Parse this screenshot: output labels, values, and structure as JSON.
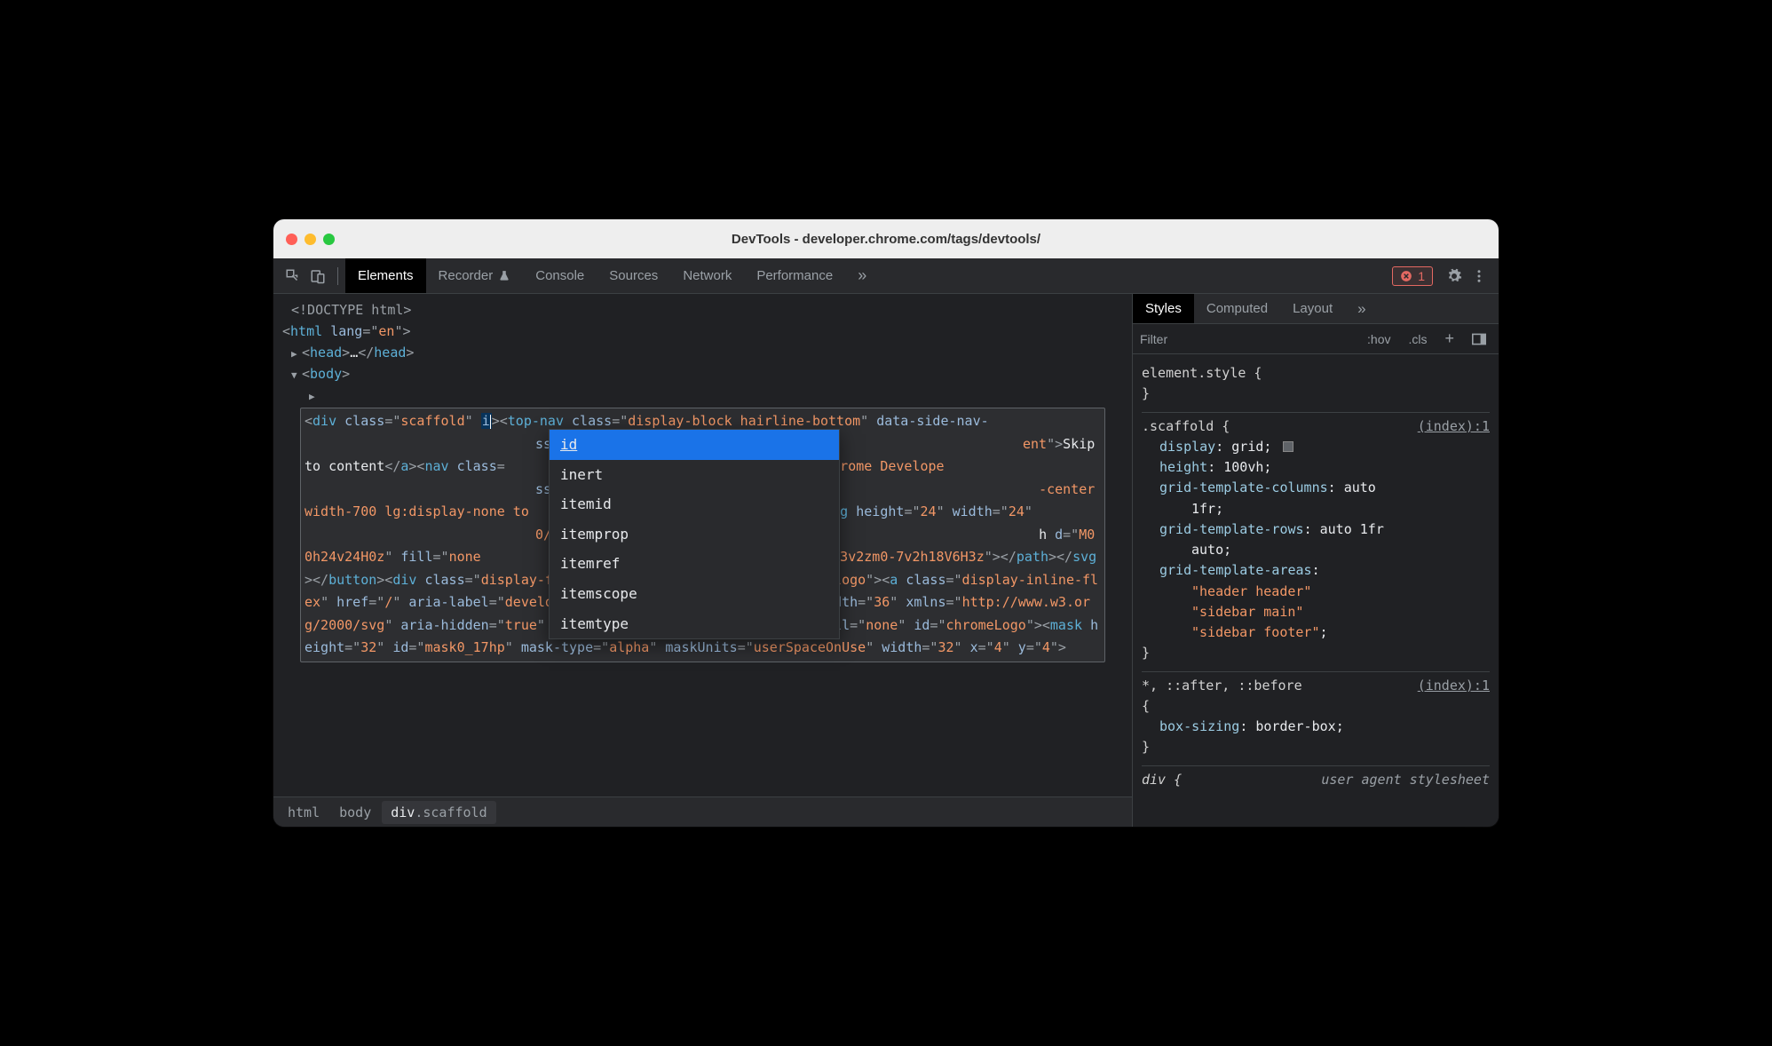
{
  "window": {
    "title": "DevTools - developer.chrome.com/tags/devtools/"
  },
  "toolbar": {
    "tabs": {
      "elements": "Elements",
      "recorder": "Recorder",
      "console": "Console",
      "sources": "Sources",
      "network": "Network",
      "performance": "Performance"
    },
    "error_count": "1"
  },
  "dom": {
    "doctype": "<!DOCTYPE html>",
    "html_open": "html",
    "html_lang_attr": "lang",
    "html_lang_val": "en",
    "head": "head",
    "body": "body",
    "editing_attr": "i",
    "html_content_lines": [
      "div class=\"scaffold\" i|><top-nav class=\"display-block hairline-",
      "bottom\" data-side-nav-                          ss=\"color-",
      "primary skip-link visu                          ent\">Skip to",
      "content</a><nav class=                          ria-",
      "label=\"Chrome Develope                          ss=\"display-",
      "flex align-center butt                          -center width-",
      "700 lg:display-none to                          \"menu\"><svg",
      "height=\"24\" width=\"24\"                          0/svg\" aria-",
      "hidden=\"true\" class=\"i                          h d=\"M0",
      "0h24v24H0z\" fill=\"none                          H3v2zm0-5h18v-",
      "2H3v2zm0-7v2h18V6H3z\"></path></svg></button><div class=\"display-",
      "flex justify-content-start top-nav__logo\"><a class=\"display-",
      "inline-flex\" href=\"/\" aria-label=\"developer.chrome.com\"><svg",
      "height=\"36\" width=\"36\" xmlns=\"http://www.w3.org/2000/svg\" aria-",
      "hidden=\"true\" class=\"icon\" viewBox=\"2 2 36 36\" fill=\"none\"",
      "id=\"chromeLogo\"><mask height=\"32\" id=\"mask0_17hp\" mask-",
      "type=\"alpha\" maskUnits=\"userSpaceOnUse\" width=\"32\" x=\"4\" y=\"4\">"
    ]
  },
  "autocomplete": {
    "items": [
      "id",
      "inert",
      "itemid",
      "itemprop",
      "itemref",
      "itemscope",
      "itemtype"
    ],
    "selected_index": 0
  },
  "breadcrumb": {
    "items": [
      {
        "tag": "html",
        "cls": ""
      },
      {
        "tag": "body",
        "cls": ""
      },
      {
        "tag": "div",
        "cls": ".scaffold"
      }
    ]
  },
  "styles": {
    "tabs": {
      "styles": "Styles",
      "computed": "Computed",
      "layout": "Layout"
    },
    "filter_placeholder": "Filter",
    "hov": ":hov",
    "cls": ".cls",
    "element_style_label": "element.style {",
    "element_style_close": "}",
    "rule1": {
      "selector": ".scaffold {",
      "origin": "(index):1",
      "props": [
        {
          "name": "display",
          "value": "grid",
          "swatch": true
        },
        {
          "name": "height",
          "value": "100vh"
        },
        {
          "name": "grid-template-columns",
          "value": "auto 1fr",
          "wrap": true
        },
        {
          "name": "grid-template-rows",
          "value": "auto 1fr auto",
          "wrap": true
        },
        {
          "name": "grid-template-areas",
          "value": "",
          "areas": [
            "\"header header\"",
            "\"sidebar main\"",
            "\"sidebar footer\""
          ]
        }
      ],
      "close": "}"
    },
    "rule2": {
      "selector": "*, ::after, ::before {",
      "origin": "(index):1",
      "props": [
        {
          "name": "box-sizing",
          "value": "border-box"
        }
      ],
      "close": "}"
    },
    "rule3": {
      "selector": "div {",
      "origin_ua": "user agent stylesheet"
    }
  }
}
